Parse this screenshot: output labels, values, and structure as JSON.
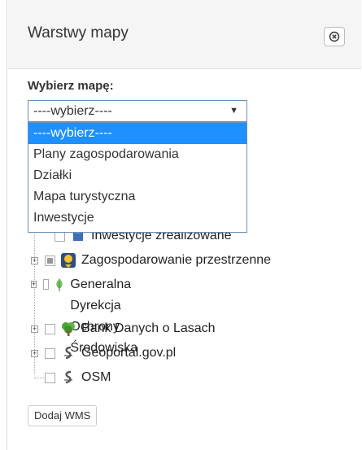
{
  "header": {
    "title": "Warstwy mapy"
  },
  "map_select": {
    "label": "Wybierz mapę:",
    "current": "----wybierz----",
    "options": [
      "----wybierz----",
      "Plany zagospodarowania",
      "Działki",
      "Mapa turystyczna",
      "Inwestycje"
    ]
  },
  "layers": [
    {
      "label": "Inwestycje zrealizowane"
    },
    {
      "label": "Zagospodarowanie przestrzenne"
    },
    {
      "label_line1": "Generalna Dyrekcja Ochrony",
      "label_line2": "Środowiska"
    },
    {
      "label": "Bank Danych o Lasach"
    },
    {
      "label": "Geoportal.gov.pl"
    },
    {
      "label": "OSM"
    }
  ],
  "add_wms": {
    "label": "Dodaj WMS"
  },
  "colors": {
    "selected_option_bg": "#1e90ff",
    "select_border": "#6a8ebd"
  }
}
